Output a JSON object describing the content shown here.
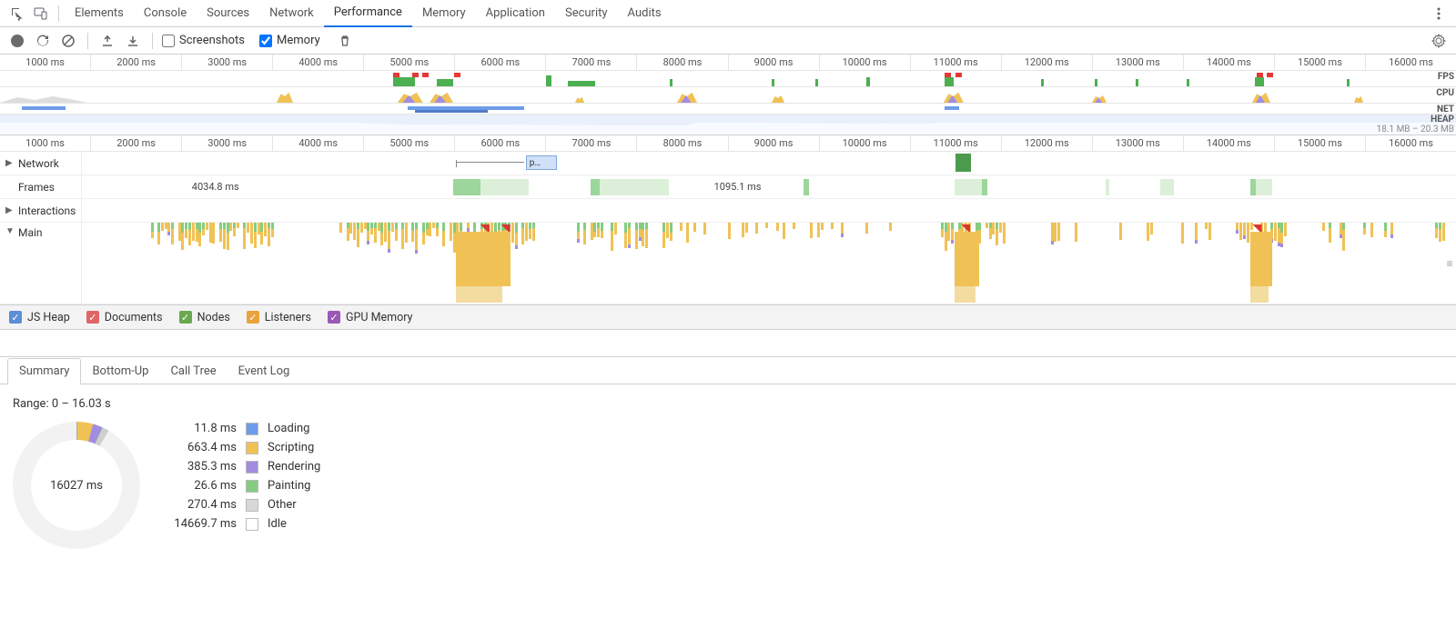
{
  "top_tabs": [
    "Elements",
    "Console",
    "Sources",
    "Network",
    "Performance",
    "Memory",
    "Application",
    "Security",
    "Audits"
  ],
  "top_tabs_active": 4,
  "toolbar": {
    "screenshots_label": "Screenshots",
    "screenshots_checked": false,
    "memory_label": "Memory",
    "memory_checked": true
  },
  "overview_ticks": [
    "1000 ms",
    "2000 ms",
    "3000 ms",
    "4000 ms",
    "5000 ms",
    "6000 ms",
    "7000 ms",
    "8000 ms",
    "9000 ms",
    "10000 ms",
    "11000 ms",
    "12000 ms",
    "13000 ms",
    "14000 ms",
    "15000 ms",
    "16000 ms"
  ],
  "overview_labels": {
    "fps": "FPS",
    "cpu": "CPU",
    "net": "NET",
    "heap": "HEAP"
  },
  "heap_range": "18.1 MB – 20.3 MB",
  "detail_ticks": [
    "1000 ms",
    "2000 ms",
    "3000 ms",
    "4000 ms",
    "5000 ms",
    "6000 ms",
    "7000 ms",
    "8000 ms",
    "9000 ms",
    "10000 ms",
    "11000 ms",
    "12000 ms",
    "13000 ms",
    "14000 ms",
    "15000 ms",
    "16000 ms"
  ],
  "tracks": {
    "network": "Network",
    "frames": "Frames",
    "interactions": "Interactions",
    "main": "Main"
  },
  "frame_labels": [
    "4034.8 ms",
    "1095.1 ms"
  ],
  "net_block_label": "p…",
  "counters": [
    {
      "label": "JS Heap",
      "color": "#5b8fd6"
    },
    {
      "label": "Documents",
      "color": "#e06666"
    },
    {
      "label": "Nodes",
      "color": "#6aa84f"
    },
    {
      "label": "Listeners",
      "color": "#e8a33d"
    },
    {
      "label": "GPU Memory",
      "color": "#9b59b6"
    }
  ],
  "summary_tabs": [
    "Summary",
    "Bottom-Up",
    "Call Tree",
    "Event Log"
  ],
  "summary_tabs_active": 0,
  "summary_range": "Range: 0 – 16.03 s",
  "summary_total": "16027 ms",
  "summary_legend": [
    {
      "val": "11.8 ms",
      "label": "Loading",
      "color": "#6f9ce8"
    },
    {
      "val": "663.4 ms",
      "label": "Scripting",
      "color": "#f0c255"
    },
    {
      "val": "385.3 ms",
      "label": "Rendering",
      "color": "#a38ce0"
    },
    {
      "val": "26.6 ms",
      "label": "Painting",
      "color": "#84cc80"
    },
    {
      "val": "270.4 ms",
      "label": "Other",
      "color": "#d8d8d8"
    },
    {
      "val": "14669.7 ms",
      "label": "Idle",
      "color": "#ffffff"
    }
  ],
  "chart_data": {
    "type": "pie",
    "title": "Time breakdown",
    "total_label": "16027 ms",
    "series": [
      {
        "name": "Loading",
        "value": 11.8,
        "color": "#6f9ce8"
      },
      {
        "name": "Scripting",
        "value": 663.4,
        "color": "#f0c255"
      },
      {
        "name": "Rendering",
        "value": 385.3,
        "color": "#a38ce0"
      },
      {
        "name": "Painting",
        "value": 26.6,
        "color": "#84cc80"
      },
      {
        "name": "Other",
        "value": 270.4,
        "color": "#d8d8d8"
      },
      {
        "name": "Idle",
        "value": 14669.7,
        "color": "#ffffff"
      }
    ]
  }
}
